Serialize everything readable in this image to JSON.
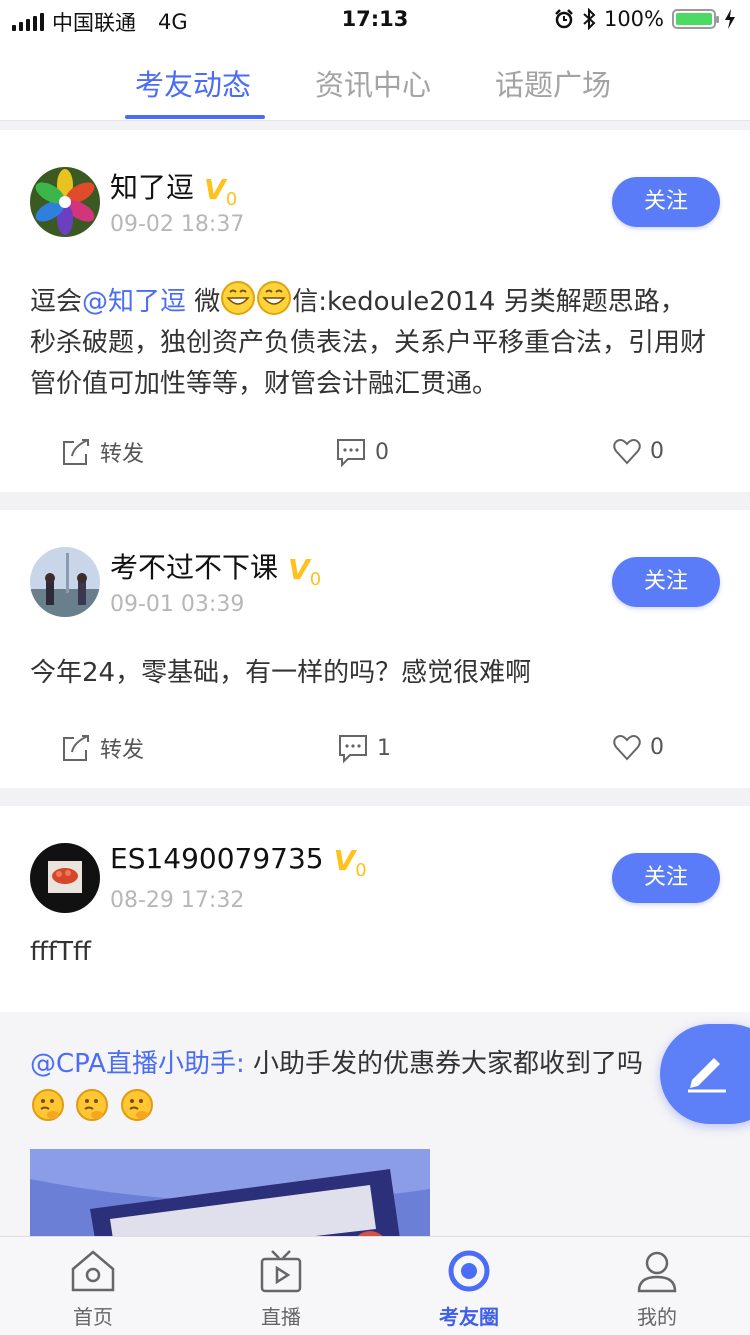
{
  "status_bar": {
    "carrier": "中国联通",
    "network": "4G",
    "time": "17:13",
    "battery": "100%",
    "battery_level": 1.0
  },
  "tabs": [
    {
      "label": "考友动态",
      "active": true
    },
    {
      "label": "资讯中心",
      "active": false
    },
    {
      "label": "话题广场",
      "active": false
    }
  ],
  "posts": [
    {
      "username": "知了逗",
      "level": "0",
      "time": "09-02 18:37",
      "follow_label": "关注",
      "text_a": "逗会",
      "mention": "@知了逗",
      "text_b": " 微",
      "text_c": "信:kedoule2014 另类解题思路，秒杀破题，独创资产负债表法，关系户平移重合法，引用财管价值可加性等等，财管会计融汇贯通。",
      "repost_label": "转发",
      "comments": "0",
      "likes": "0"
    },
    {
      "username": "考不过不下课",
      "level": "0",
      "time": "09-01 03:39",
      "follow_label": "关注",
      "text": "今年24，零基础，有一样的吗？感觉很难啊",
      "repost_label": "转发",
      "comments": "1",
      "likes": "0"
    },
    {
      "username": "ES1490079735",
      "level": "0",
      "time": "08-29 17:32",
      "follow_label": "关注",
      "text": "fffTff",
      "repost": {
        "mention": "@CPA直播小助手:",
        "text": " 小助手发的优惠券大家都收到了吗"
      }
    }
  ],
  "bottom_nav": [
    {
      "label": "首页",
      "icon": "home-icon",
      "active": false
    },
    {
      "label": "直播",
      "icon": "tv-icon",
      "active": false
    },
    {
      "label": "考友圈",
      "icon": "circle-icon",
      "active": true
    },
    {
      "label": "我的",
      "icon": "user-icon",
      "active": false
    }
  ],
  "colors": {
    "accent": "#4a6cf7",
    "badge": "#ffc21c",
    "follow_button": "#5b7cf8"
  }
}
